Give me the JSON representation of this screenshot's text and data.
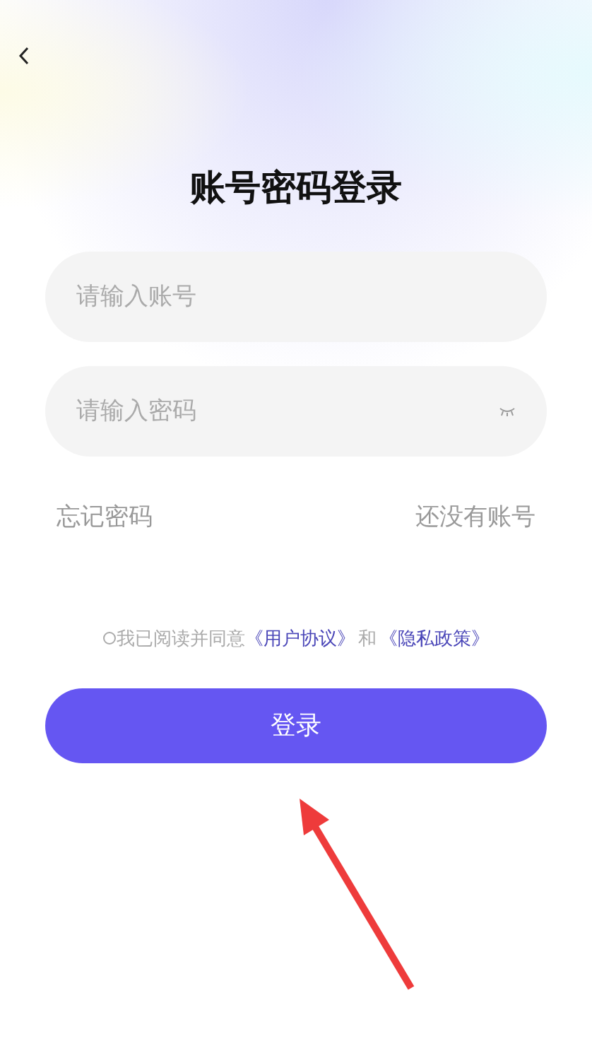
{
  "title": "账号密码登录",
  "fields": [
    {
      "placeholder": "请输入账号",
      "kind": "text"
    },
    {
      "placeholder": "请输入密码",
      "kind": "password"
    }
  ],
  "links": [
    "忘记密码",
    "还没有账号"
  ],
  "agreement": {
    "checked": false,
    "text": "我已阅读并同意",
    "terms": "《用户协议》",
    "and": "和",
    "privacy": "《隐私政策》"
  },
  "button": "登录"
}
